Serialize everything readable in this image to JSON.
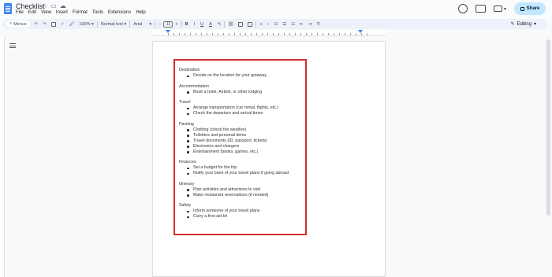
{
  "document": {
    "title": "Checklist"
  },
  "menu": [
    "File",
    "Edit",
    "View",
    "Insert",
    "Format",
    "Tools",
    "Extensions",
    "Help"
  ],
  "header": {
    "share_label": "Share"
  },
  "toolbar": {
    "menus_label": "Menus",
    "zoom": "100%",
    "style": "Normal text",
    "font": "Arial",
    "font_size": "11",
    "bold": "B",
    "italic": "I",
    "underline": "U",
    "text_color": "A",
    "mode_label": "Editing"
  },
  "content": {
    "sections": [
      {
        "heading": "Destination",
        "items": [
          "Decide on the location for your getaway"
        ]
      },
      {
        "heading": "Accommodation",
        "items": [
          "Book a hotel, Airbnb, or other lodging"
        ]
      },
      {
        "heading": "Travel",
        "items": [
          "Arrange transportation (car rental, flights, etc.)",
          "Check the departure and arrival times"
        ]
      },
      {
        "heading": "Packing",
        "items": [
          "Clothing (check the weather)",
          "Toiletries and personal items",
          "Travel documents (ID, passport, tickets)",
          "Electronics and chargers",
          "Entertainment (books, games, etc.)"
        ]
      },
      {
        "heading": "Finances",
        "items": [
          "Set a budget for the trip",
          "Notify your bank of your travel plans if going abroad"
        ]
      },
      {
        "heading": "Itinerary",
        "items": [
          "Plan activities and attractions to visit",
          "Make restaurant reservations (if needed)"
        ]
      },
      {
        "heading": "Safety",
        "items": [
          "Inform someone of your travel plans",
          "Carry a first-aid kit"
        ]
      }
    ]
  },
  "colors": {
    "highlight_border": "#d32f2f",
    "share_bg": "#c2e7ff",
    "toolbar_bg": "#edf2fa"
  }
}
